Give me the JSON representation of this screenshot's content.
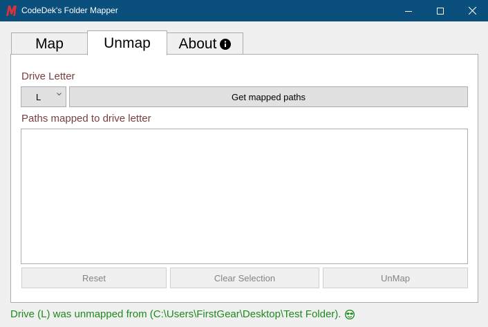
{
  "window": {
    "title": "CodeDek's Folder Mapper",
    "titlebar_color": "#0b4f7d",
    "icon": "app-logo-m-icon",
    "controls": [
      "minimize-icon",
      "maximize-icon",
      "close-icon"
    ]
  },
  "tabs": [
    {
      "label": "Map",
      "active": false
    },
    {
      "label": "Unmap",
      "active": true
    },
    {
      "label": "About",
      "active": false,
      "icon": "info-icon"
    }
  ],
  "unmap": {
    "drive_letter_label": "Drive Letter",
    "drive_letter_value": "L",
    "get_paths_label": "Get mapped paths",
    "paths_label": "Paths mapped to drive letter",
    "paths": [],
    "reset_label": "Reset",
    "clear_selection_label": "Clear Selection",
    "unmap_label": "UnMap"
  },
  "status": {
    "message": "Drive (L) was unmapped from (C:\\Users\\FirstGear\\Desktop\\Test Folder).",
    "icon": "smiley-icon",
    "color": "#1c8a1c"
  },
  "colors": {
    "label_text": "#7a3e3e"
  }
}
